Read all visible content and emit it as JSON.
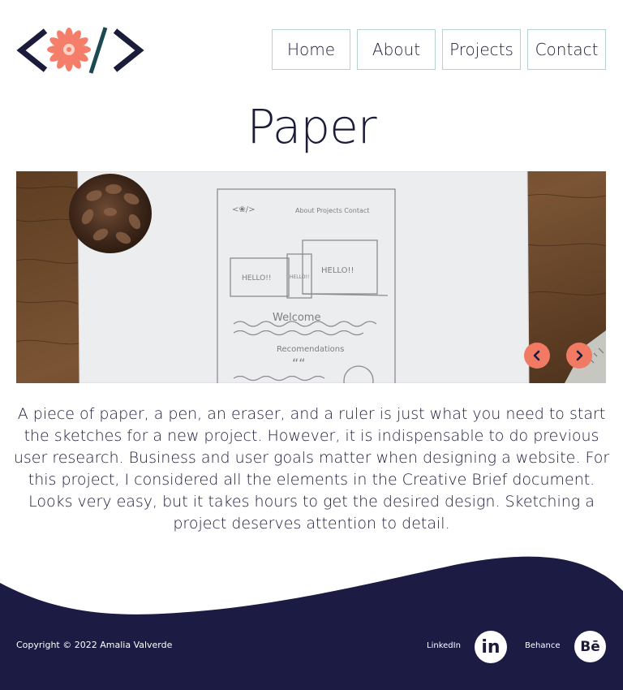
{
  "header": {
    "nav": [
      {
        "label": "Home"
      },
      {
        "label": "About"
      },
      {
        "label": "Projects"
      },
      {
        "label": "Contact"
      }
    ]
  },
  "page": {
    "title": "Paper",
    "description": "A piece of paper, a pen, an eraser, and a ruler is just what you need to start the sketches for a new project. However, it is indispensable to do previous user research. Business and user goals matter when designing a website. For this project, I considered all the elements in the Creative Brief document. Looks very easy, but it takes hours to get the desired design. Sketching a project deserves attention to detail."
  },
  "carousel": {
    "sketch_text": {
      "nav": "About  Projects  Contact",
      "hello_tablet": "HELLO!!",
      "hello_phone": "HELLO!!",
      "hello_desktop": "HELLO!!",
      "welcome": "Welcome",
      "recommendations": "Recomendations",
      "quote_mark": "““"
    },
    "prev_icon": "chevron-left-icon",
    "next_icon": "chevron-right-icon"
  },
  "footer": {
    "copyright": "Copyright © 2022 Amalia Valverde",
    "linkedin_label": "LinkedIn",
    "linkedin_glyph": "in",
    "behance_label": "Behance",
    "behance_glyph": "Bē"
  },
  "colors": {
    "navy": "#1b1b3a",
    "accent": "#f07a63",
    "nav_border": "#b7d3cf"
  }
}
